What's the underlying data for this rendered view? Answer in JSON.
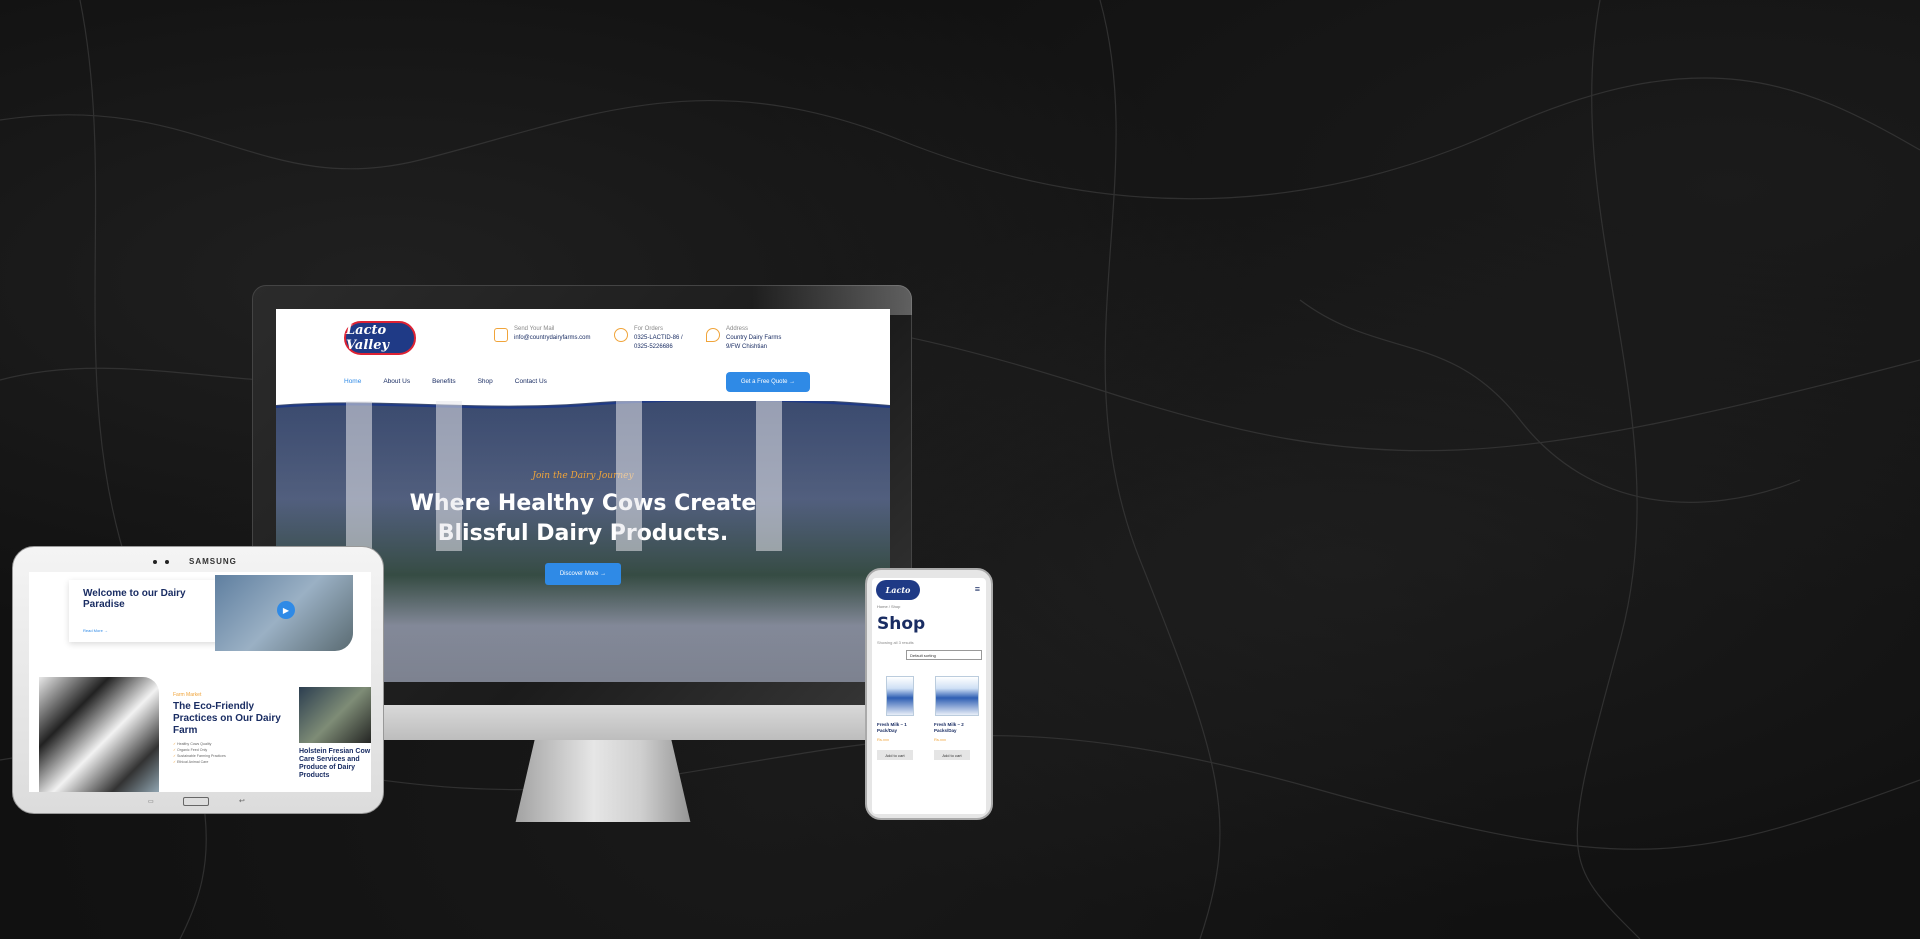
{
  "desktop": {
    "logo_text": "Lacto Valley",
    "contacts": [
      {
        "label": "Send Your Mail",
        "value": "info@countrydairyfarms.com"
      },
      {
        "label": "For Orders",
        "value": "0325-LACTID-86 /",
        "value2": "0325-5226686"
      },
      {
        "label": "Address",
        "value": "Country Dairy Farms",
        "value2": "9/FW Chishtian"
      }
    ],
    "nav": [
      "Home",
      "About Us",
      "Benefits",
      "Shop",
      "Contact Us"
    ],
    "quote_button": "Get a Free Quote →",
    "hero": {
      "subtitle": "Join the Dairy Journey",
      "title_line1": "Where Healthy Cows Create",
      "title_line2": "Blissful Dairy Products.",
      "button": "Discover More →"
    }
  },
  "tablet": {
    "brand": "SAMSUNG",
    "welcome_title": "Welcome to our Dairy Paradise",
    "welcome_more": "Read More →",
    "eco_tag": "Farm Market",
    "eco_title": "The Eco-Friendly Practices on Our Dairy Farm",
    "eco_points": [
      "Healthy Cows Quality",
      "Organic Feed Only",
      "Sustainable Farming Practices",
      "Ethical Animal Care"
    ],
    "holstein_title": "Holstein Fresian Cow Care Services and Produce of Dairy Products"
  },
  "phone": {
    "logo_text": "Lacto",
    "menu_icon": "≡",
    "breadcrumb": "Home / Shop",
    "title": "Shop",
    "showing": "Showing all 3 results",
    "sort": "Default sorting",
    "products": [
      {
        "name": "Fresh Milk – 1 Pack/Day",
        "price": "Rs.xxx",
        "cart": "Add to cart"
      },
      {
        "name": "Fresh Milk – 2 Packs/Day",
        "price": "Rs.xxx",
        "cart": "Add to cart"
      }
    ]
  },
  "colors": {
    "navy": "#1a2d63",
    "accent": "#2f8ae6",
    "orange": "#f0a43a"
  }
}
